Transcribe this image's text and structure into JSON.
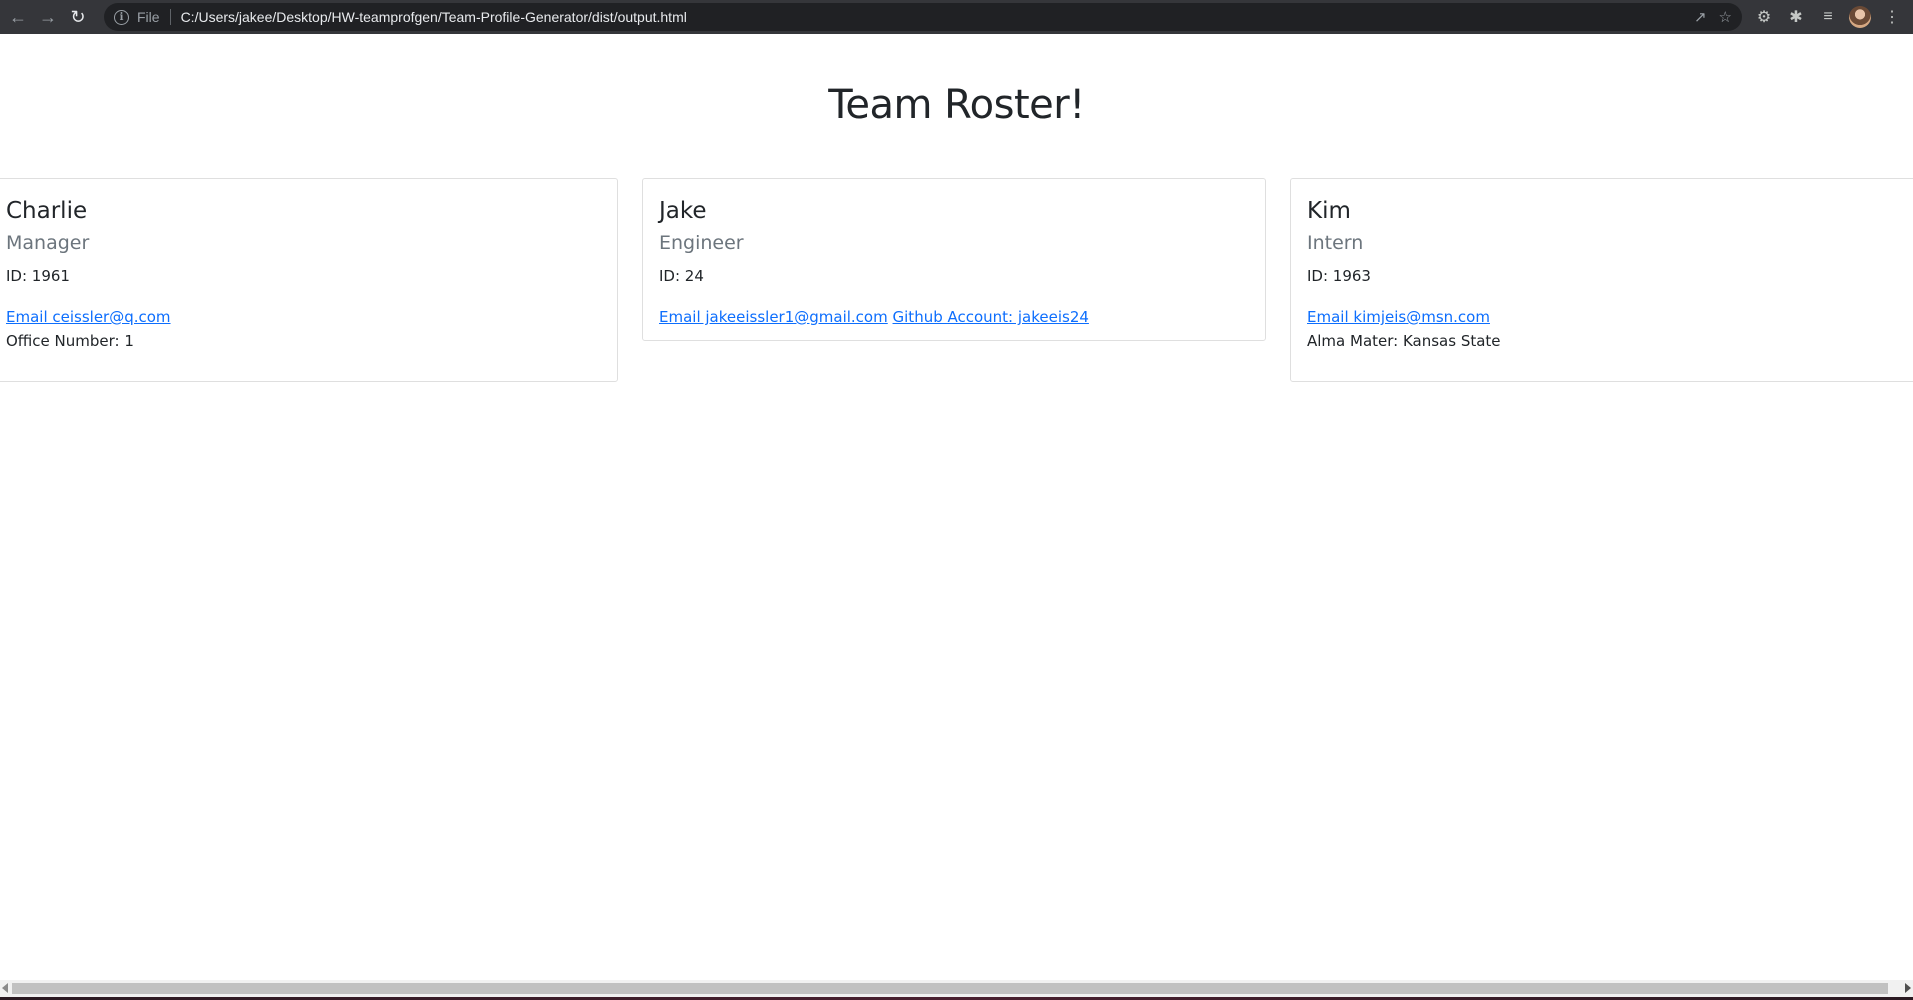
{
  "browser": {
    "omnibox": {
      "scheme_label": "File",
      "url": "C:/Users/jakee/Desktop/HW-teamprofgen/Team-Profile-Generator/dist/output.html"
    }
  },
  "page": {
    "title": "Team Roster!"
  },
  "team": [
    {
      "name": "Charlie",
      "role": "Manager",
      "id": "ID: 1961",
      "email_link": "Email ceissler@q.com",
      "extra_text": "Office Number: 1"
    },
    {
      "name": "Jake",
      "role": "Engineer",
      "id": "ID: 24",
      "email_link": "Email jakeeissler1@gmail.com",
      "github_link": "Github Account: jakeeis24"
    },
    {
      "name": "Kim",
      "role": "Intern",
      "id": "ID: 1963",
      "email_link": "Email kimjeis@msn.com",
      "extra_text": "Alma Mater: Kansas State"
    }
  ]
}
